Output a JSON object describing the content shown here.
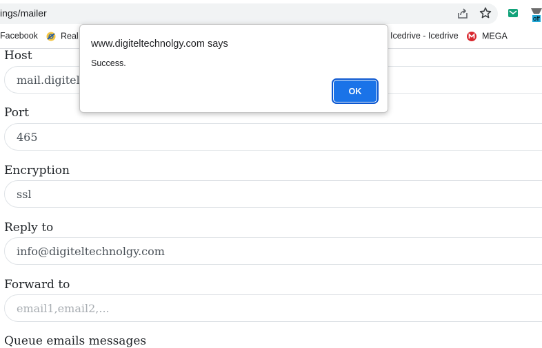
{
  "browser": {
    "url": "ings/mailer",
    "bookmarks": [
      {
        "label": "Facebook",
        "icon": "facebook-bookmark"
      },
      {
        "label": "Real",
        "icon": "real-bookmark-icon"
      },
      {
        "label": "Icedrive - Icedrive",
        "icon": "icedrive-icon"
      },
      {
        "label": "MEGA",
        "icon": "mega-icon"
      }
    ],
    "extension_badge": "off"
  },
  "form": {
    "host": {
      "label": "Host",
      "value": "mail.digitelt"
    },
    "port": {
      "label": "Port",
      "value": "465"
    },
    "encryption": {
      "label": "Encryption",
      "value": "ssl"
    },
    "reply_to": {
      "label": "Reply to",
      "value": "info@digiteltechnolgy.com"
    },
    "forward_to": {
      "label": "Forward to",
      "placeholder": "email1,email2,..."
    },
    "queue": {
      "label": "Queue emails messages"
    }
  },
  "dialog": {
    "title": "www.digiteltechnolgy.com says",
    "message": "Success.",
    "ok_label": "OK"
  },
  "colors": {
    "accent": "#1a73e8",
    "mega": "#d9272e"
  }
}
